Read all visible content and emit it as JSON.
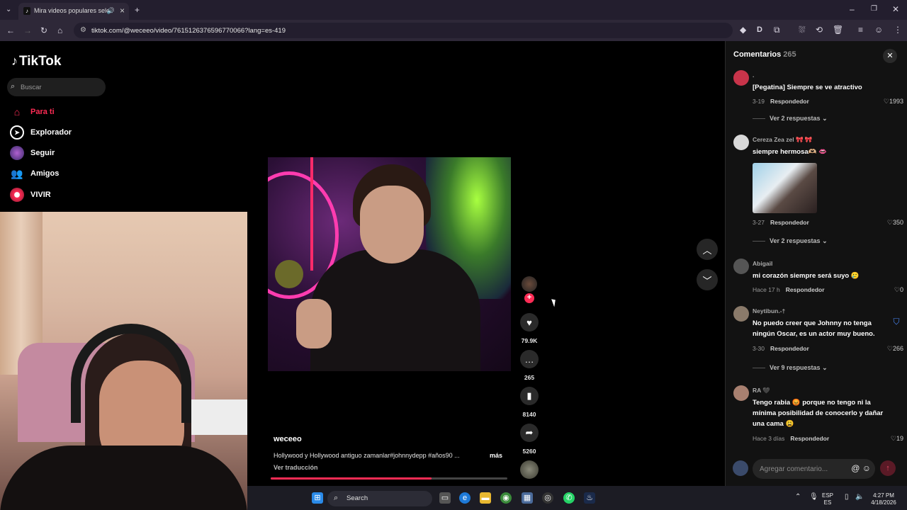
{
  "browser": {
    "tab_title": "Mira videos populares sele",
    "url": "tiktok.com/@weceeo/video/7615126376596770066?lang=es-419"
  },
  "sidebar": {
    "logo": "TikTok",
    "search_placeholder": "Buscar",
    "items": [
      {
        "label": "Para ti",
        "icon": "home-icon"
      },
      {
        "label": "Explorador",
        "icon": "compass-icon"
      },
      {
        "label": "Seguir",
        "icon": "following-avatar-icon"
      },
      {
        "label": "Amigos",
        "icon": "friends-icon"
      },
      {
        "label": "VIVIR",
        "icon": "live-icon"
      }
    ]
  },
  "video": {
    "username": "weceeo",
    "description": "Hollywood y Hollywood antiguo zamanlar#johnnydepp #años90 ...",
    "more": "más",
    "translate": "Ver traducción",
    "progress": 0.68,
    "likes": "79.9K",
    "comments": "265",
    "saves": "8140",
    "shares": "5260"
  },
  "comments": {
    "title": "Comentarios",
    "count": "265",
    "input_placeholder": "Agregar comentario...",
    "items": [
      {
        "user": ".",
        "text": "[Pegatina] Siempre se ve atractivo",
        "date": "3-19",
        "reply": "Respondedor",
        "likes": "1993",
        "replies": "Ver 2 respuestas",
        "avatar_color": "#c8344a"
      },
      {
        "user": "Cereza Zea zel 🎀 🎀",
        "text": "siempre hermosa🫶🏼 👄",
        "date": "3-27",
        "reply": "Respondedor",
        "likes": "350",
        "replies": "Ver 2 respuestas",
        "avatar_color": "#d8d8d8"
      },
      {
        "user": "Abigail",
        "text": "mi corazón siempre será suyo 🥲",
        "date": "Hace 17 h",
        "reply": "Respondedor",
        "likes": "0",
        "avatar_color": "#555555"
      },
      {
        "user": "Neytibun.-†",
        "text": "No puedo creer que Johnny no tenga ningún Oscar, es un actor muy bueno.",
        "date": "3-30",
        "reply": "Respondedor",
        "likes": "266",
        "replies": "Ver 9 respuestas",
        "avatar_color": "#8a7a6a"
      },
      {
        "user": "RA 🖤",
        "text": "Tengo rabia 😡 porque no tengo ni la mínima posibilidad de conocerlo y dañar una cama 😩",
        "date": "Hace 3 días",
        "reply": "Respondedor",
        "likes": "19",
        "avatar_color": "#a88070"
      }
    ]
  },
  "taskbar": {
    "search": "Search",
    "lang_top": "ESP",
    "lang_bottom": "ES",
    "time": "4:27 PM",
    "date": "4/18/2026"
  }
}
